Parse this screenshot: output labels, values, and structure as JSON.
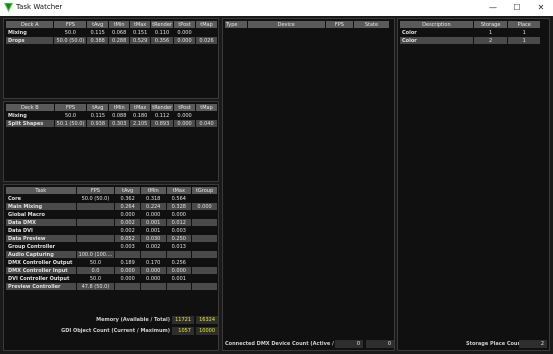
{
  "window": {
    "title": "Task Watcher",
    "minimize": "—",
    "maximize": "☐",
    "close": "✕"
  },
  "deckA": {
    "headers": [
      "Deck A",
      "FPS",
      "tAvg",
      "tMin",
      "tMax",
      "tRender",
      "tPost",
      "tMap"
    ],
    "rows": [
      [
        "Mixing",
        "50.0",
        "0.115",
        "0.068",
        "0.151",
        "0.110",
        "0.000",
        ""
      ],
      [
        "Drops",
        "50.0 (50.0)",
        "0.388",
        "0.288",
        "0.529",
        "0.356",
        "0.000",
        "0.026"
      ]
    ]
  },
  "deckB": {
    "headers": [
      "Deck B",
      "FPS",
      "tAvg",
      "tMin",
      "tMax",
      "tRender",
      "tPost",
      "tMap"
    ],
    "rows": [
      [
        "Mixing",
        "50.0",
        "0.115",
        "0.088",
        "0.180",
        "0.112",
        "0.000",
        ""
      ],
      [
        "Split Shapes",
        "50.1 (50.0)",
        "0.938",
        "0.303",
        "2.105",
        "0.893",
        "0.000",
        "0.040"
      ]
    ]
  },
  "tasks": {
    "headers": [
      "Task",
      "FPS",
      "tAvg",
      "tMin",
      "tMax",
      "tGroup"
    ],
    "rows": [
      [
        "Core",
        "50.0 (50.0)",
        "0.362",
        "0.318",
        "0.564",
        ""
      ],
      [
        "Main Mixing",
        "",
        "0.264",
        "0.224",
        "0.328",
        "0.000"
      ],
      [
        "Global Macro",
        "",
        "0.000",
        "0.000",
        "0.000",
        ""
      ],
      [
        "Data DMX",
        "",
        "0.002",
        "0.001",
        "0.012",
        ""
      ],
      [
        "Data DVI",
        "",
        "0.002",
        "0.001",
        "0.003",
        ""
      ],
      [
        "Data Preview",
        "",
        "0.052",
        "0.030",
        "0.250",
        ""
      ],
      [
        "Group Controller",
        "",
        "0.003",
        "0.002",
        "0.013",
        ""
      ],
      [
        "Audio Capturing",
        "100.0 (100....",
        "",
        "",
        "",
        ""
      ],
      [
        "DMX Controller Output",
        "50.0",
        "0.189",
        "0.170",
        "0.256",
        ""
      ],
      [
        "DMX Controller Input",
        "0.0",
        "0.000",
        "0.000",
        "0.000",
        ""
      ],
      [
        "DVI Controller Output",
        "50.0",
        "0.000",
        "0.000",
        "0.001",
        ""
      ],
      [
        "Preview Controller",
        "47.8 (50.0)",
        "",
        "",
        "",
        ""
      ]
    ],
    "memory_label": "Memory (Available / Total)",
    "memory_available": "11721",
    "memory_total": "16324",
    "gdi_label": "GDI Object Count (Current / Maximum)",
    "gdi_current": "1057",
    "gdi_maximum": "10000"
  },
  "devices": {
    "headers": [
      "Type",
      "Device",
      "FPS",
      "State"
    ],
    "footer_label": "Connected DMX Device Count (Active / All)",
    "active": "0",
    "all": "0"
  },
  "storage": {
    "headers": [
      "Description",
      "Storage",
      "Place"
    ],
    "rows": [
      [
        "Color",
        "1",
        "1"
      ],
      [
        "Color",
        "2",
        "1"
      ]
    ],
    "footer_label": "Storage Place Count",
    "count": "2"
  },
  "colors": {
    "accent": "#e6e81a",
    "header": "#5a5a5a",
    "row_alt": "#4a4a4a"
  }
}
